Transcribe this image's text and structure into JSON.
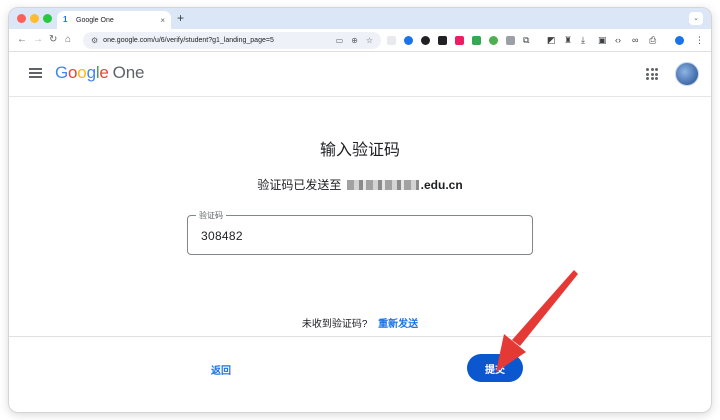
{
  "browser": {
    "tab_title": "Google One",
    "tab_close": "×",
    "new_tab": "+",
    "url_host": "one.google.com",
    "url_path": "/u/6/verify/student?g1_landing_page=5",
    "icons": [
      "back-icon",
      "forward-icon",
      "reload-icon",
      "home-icon",
      "tune-icon",
      "cast-icon",
      "zoom-icon",
      "star-icon",
      "extensions-icon",
      "downloads-icon",
      "print-icon",
      "profile-icon",
      "more-icon"
    ]
  },
  "header": {
    "logo_google": [
      "G",
      "o",
      "o",
      "g",
      "l",
      "e"
    ],
    "logo_product": "One"
  },
  "main": {
    "title": "输入验证码",
    "sent_prefix": "验证码已发送至",
    "sent_domain": ".edu.cn",
    "field_label": "验证码",
    "field_value": "308482",
    "resend_prompt": "未收到验证码?",
    "resend_link": "重新发送"
  },
  "footer": {
    "back_label": "返回",
    "submit_label": "提交"
  },
  "colors": {
    "accent": "#1a73e8",
    "submit_bg": "#0b57d0",
    "annotation": "#e53935"
  }
}
